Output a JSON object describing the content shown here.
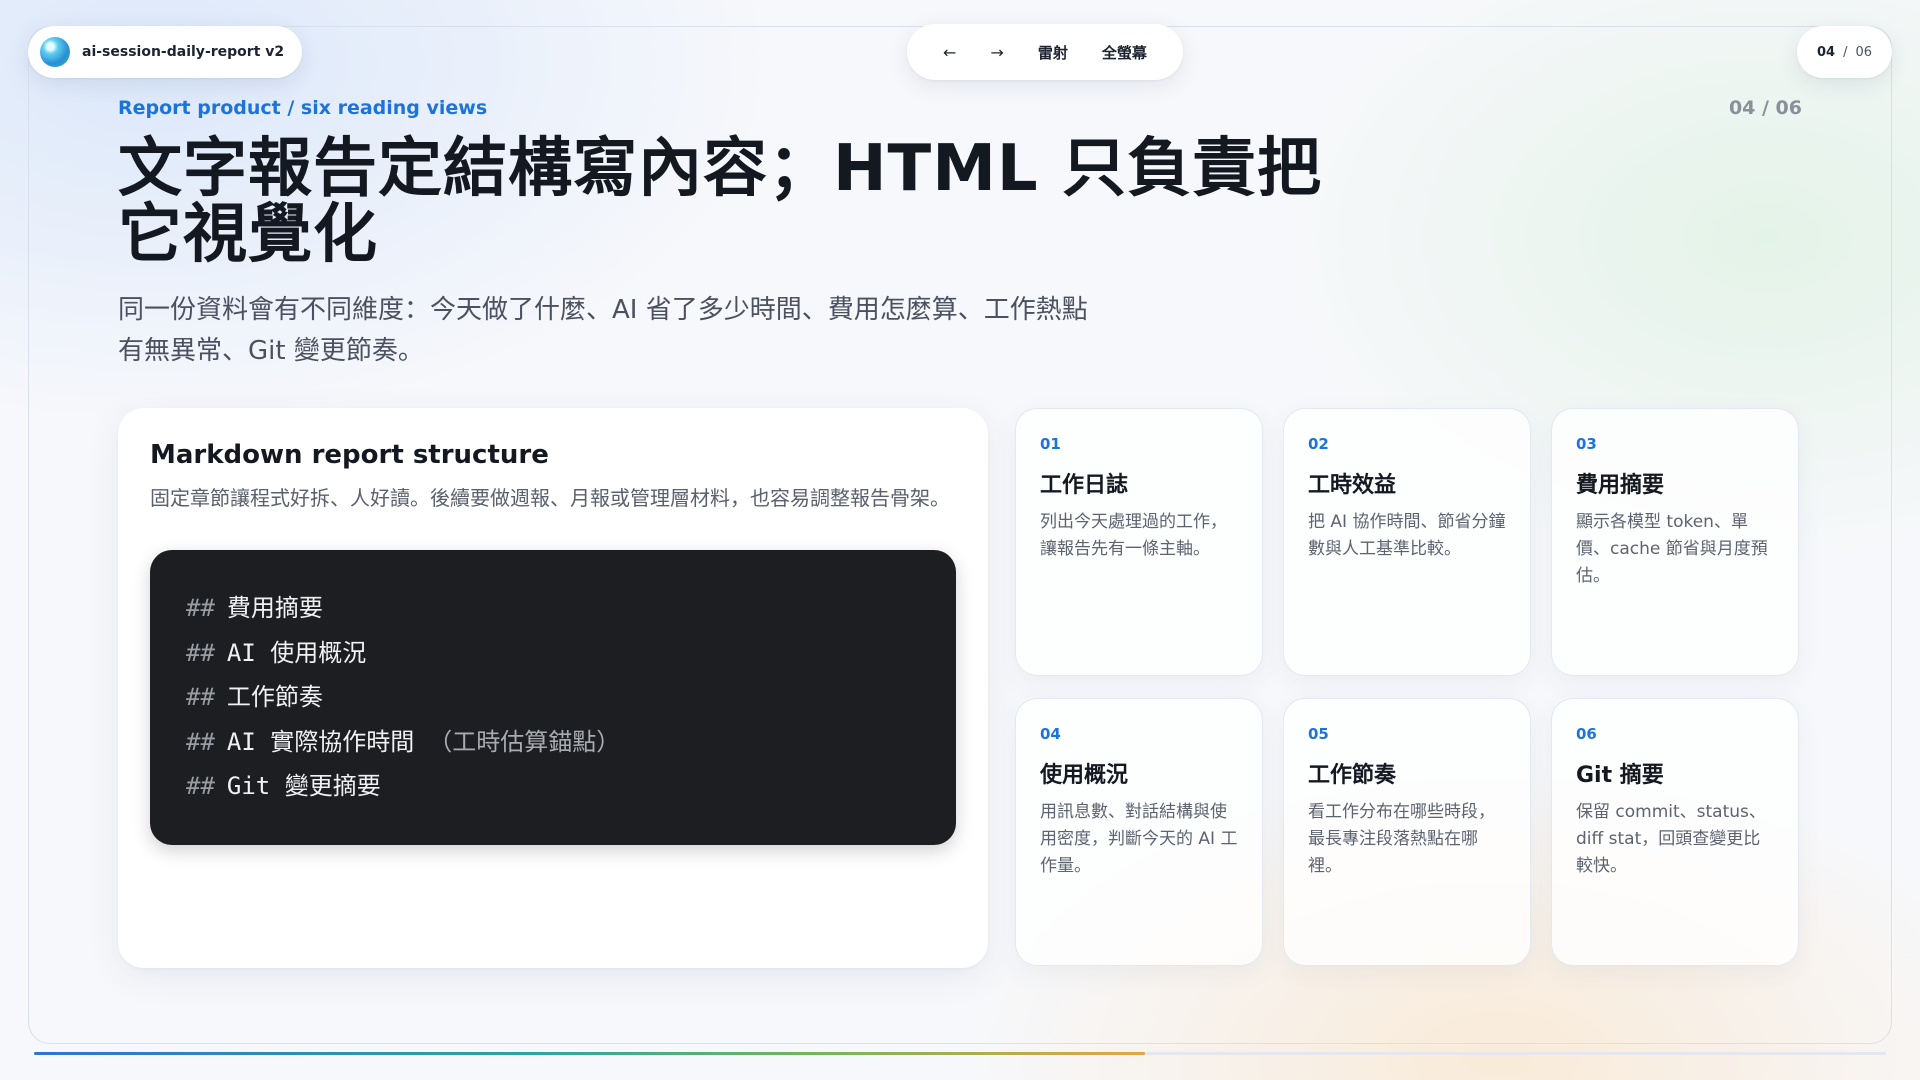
{
  "app": {
    "name": "ai-session-daily-report v2"
  },
  "nav": {
    "prev": "←",
    "next": "→",
    "radar": "雷射",
    "fullscreen": "全螢幕"
  },
  "pager": {
    "current": "04",
    "separator": "/",
    "total": "06",
    "progress": 0.6
  },
  "header": {
    "eyebrow": "Report product / six reading views",
    "counter": "04 / 06",
    "title": "文字報告定結構寫內容；HTML 只負責把它視覺化",
    "subtitle": "同一份資料會有不同維度：今天做了什麼、AI 省了多少時間、費用怎麼算、工作熱點有無異常、Git 變更節奏。"
  },
  "structure": {
    "title": "Markdown report structure",
    "description": "固定章節讓程式好拆、人好讀。後續要做週報、月報或管理層材料，也容易調整報告骨架。",
    "code_lines": [
      {
        "hash": "##",
        "text": "費用摘要",
        "note": ""
      },
      {
        "hash": "##",
        "text": "AI 使用概況",
        "note": ""
      },
      {
        "hash": "##",
        "text": "工作節奏",
        "note": ""
      },
      {
        "hash": "##",
        "text": "AI 實際協作時間",
        "note": "（工時估算錨點）"
      },
      {
        "hash": "##",
        "text": "Git 變更摘要",
        "note": ""
      }
    ]
  },
  "views": [
    {
      "num": "01",
      "title": "工作日誌",
      "desc": "列出今天處理過的工作，讓報告先有一條主軸。"
    },
    {
      "num": "02",
      "title": "工時效益",
      "desc": "把 AI 協作時間、節省分鐘數與人工基準比較。"
    },
    {
      "num": "03",
      "title": "費用摘要",
      "desc": "顯示各模型 token、單價、cache 節省與月度預估。"
    },
    {
      "num": "04",
      "title": "使用概況",
      "desc": "用訊息數、對話結構與使用密度，判斷今天的 AI 工作量。"
    },
    {
      "num": "05",
      "title": "工作節奏",
      "desc": "看工作分布在哪些時段，最長專注段落熱點在哪裡。"
    },
    {
      "num": "06",
      "title": "Git 摘要",
      "desc": "保留 commit、status、diff stat，回頭查變更比較快。"
    }
  ]
}
